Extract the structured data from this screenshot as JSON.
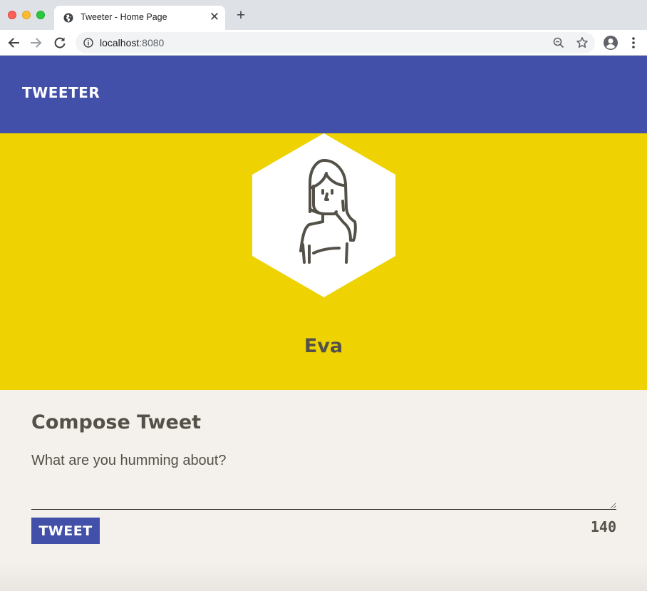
{
  "browser": {
    "tab_title": "Tweeter - Home Page",
    "tab_close": "✕",
    "new_tab": "+",
    "url_host": "localhost",
    "url_port": ":8080"
  },
  "header": {
    "brand": "TWEETER",
    "brand_color": "#4350aa"
  },
  "profile": {
    "name": "Eva",
    "band_color": "#eed202",
    "avatar": "woman-avatar-icon"
  },
  "compose": {
    "title": "Compose Tweet",
    "placeholder": "What are you humming about?",
    "button_label": "TWEET",
    "char_count": "140"
  }
}
